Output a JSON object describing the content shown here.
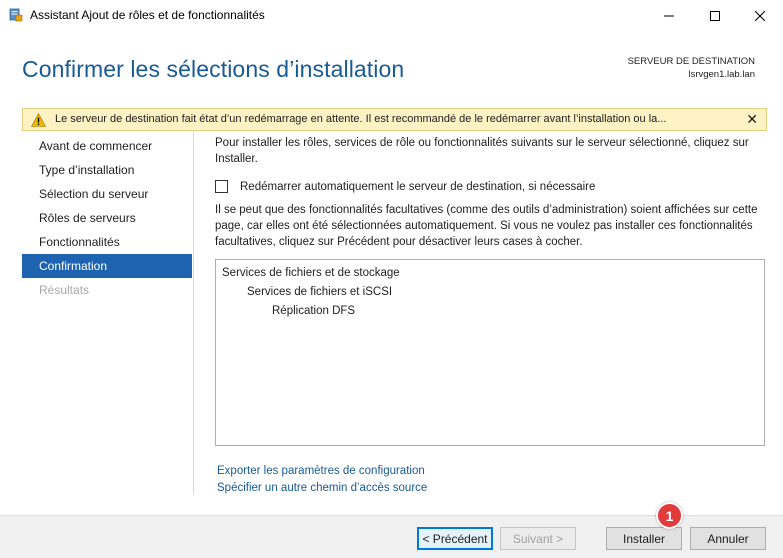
{
  "window": {
    "title": "Assistant Ajout de rôles et de fonctionnalités"
  },
  "header": {
    "page_title": "Confirmer les sélections d’installation",
    "destination_label": "SERVEUR DE DESTINATION",
    "destination_server": "lsrvgen1.lab.lan"
  },
  "warning": {
    "text": "Le serveur de destination fait état d’un redémarrage en attente. Il est recommandé de le redémarrer avant l’installation ou la...",
    "close_glyph": "✕"
  },
  "nav": {
    "items": [
      {
        "label": "Avant de commencer",
        "state": "normal"
      },
      {
        "label": "Type d’installation",
        "state": "normal"
      },
      {
        "label": "Sélection du serveur",
        "state": "normal"
      },
      {
        "label": "Rôles de serveurs",
        "state": "normal"
      },
      {
        "label": "Fonctionnalités",
        "state": "normal"
      },
      {
        "label": "Confirmation",
        "state": "active"
      },
      {
        "label": "Résultats",
        "state": "disabled"
      }
    ]
  },
  "main": {
    "intro": "Pour installer les rôles, services de rôle ou fonctionnalités suivants sur le serveur sélectionné, cliquez sur Installer.",
    "restart_checkbox_label": "Redémarrer automatiquement le serveur de destination, si nécessaire",
    "optional_note": "Il se peut que des fonctionnalités facultatives (comme des outils d’administration) soient affichées sur cette page, car elles ont été sélectionnées automatiquement. Si vous ne voulez pas installer ces fonctionnalités facultatives, cliquez sur Précédent pour désactiver leurs cases à cocher.",
    "features": [
      {
        "label": "Services de fichiers et de stockage",
        "level": 0
      },
      {
        "label": "Services de fichiers et iSCSI",
        "level": 1
      },
      {
        "label": "Réplication DFS",
        "level": 2
      }
    ],
    "export_link": "Exporter les paramètres de configuration",
    "source_path_link": "Spécifier un autre chemin d’accès source"
  },
  "footer": {
    "prev_label": "< Précédent",
    "next_label": "Suivant >",
    "install_label": "Installer",
    "cancel_label": "Annuler"
  },
  "annotation": {
    "badge_number": "1"
  },
  "colors": {
    "title_blue": "#1a5a94",
    "nav_active": "#1e63b0",
    "warning_bg": "#fcf2c4",
    "badge_red": "#e23b3b"
  }
}
